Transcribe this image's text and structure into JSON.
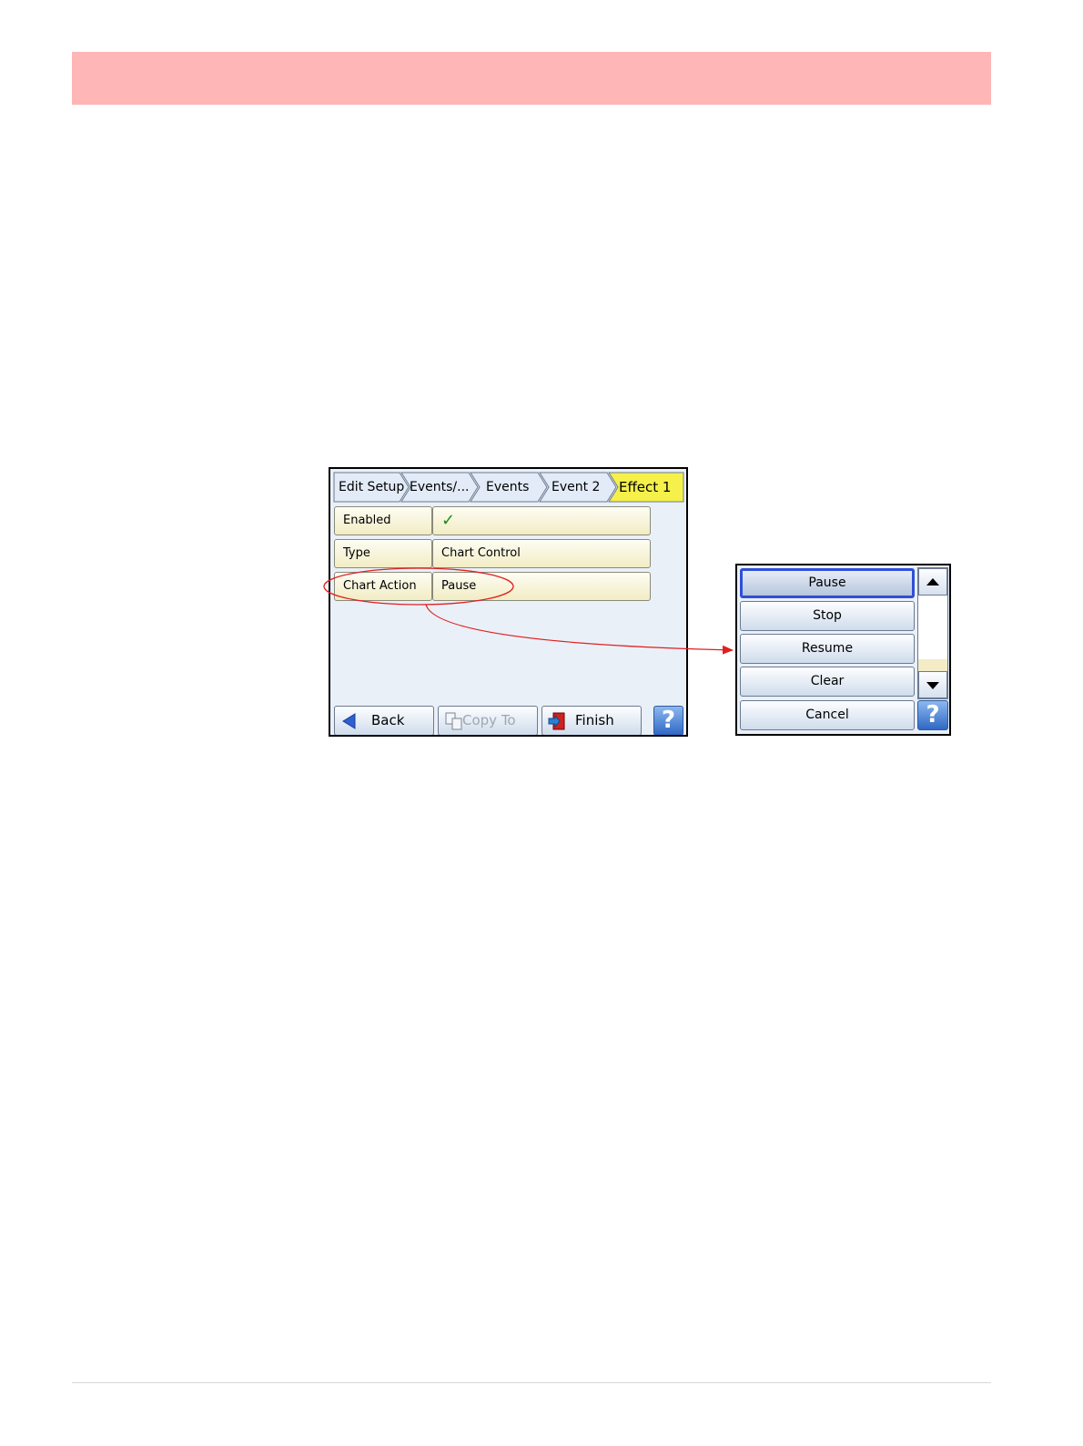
{
  "breadcrumb": {
    "items": [
      {
        "label": "Edit Setup"
      },
      {
        "label": "Events/..."
      },
      {
        "label": "Events"
      },
      {
        "label": "Event 2"
      },
      {
        "label": "Effect 1"
      }
    ]
  },
  "settings": {
    "rows": [
      {
        "label": "Enabled",
        "value": "✓"
      },
      {
        "label": "Type",
        "value": "Chart Control"
      },
      {
        "label": "Chart Action",
        "value": "Pause"
      }
    ]
  },
  "toolbar": {
    "back_label": "Back",
    "copy_label": "Copy To",
    "finish_label": "Finish",
    "help_label": "?"
  },
  "popup": {
    "options": [
      "Pause",
      "Stop",
      "Resume",
      "Clear"
    ],
    "selected": "Pause",
    "cancel_label": "Cancel",
    "help_label": "?"
  },
  "colors": {
    "header_band": "#ffb6b6",
    "active_crumb": "#f5f04a",
    "annotation": "#e02020",
    "selection_border": "#2f4fd8"
  }
}
